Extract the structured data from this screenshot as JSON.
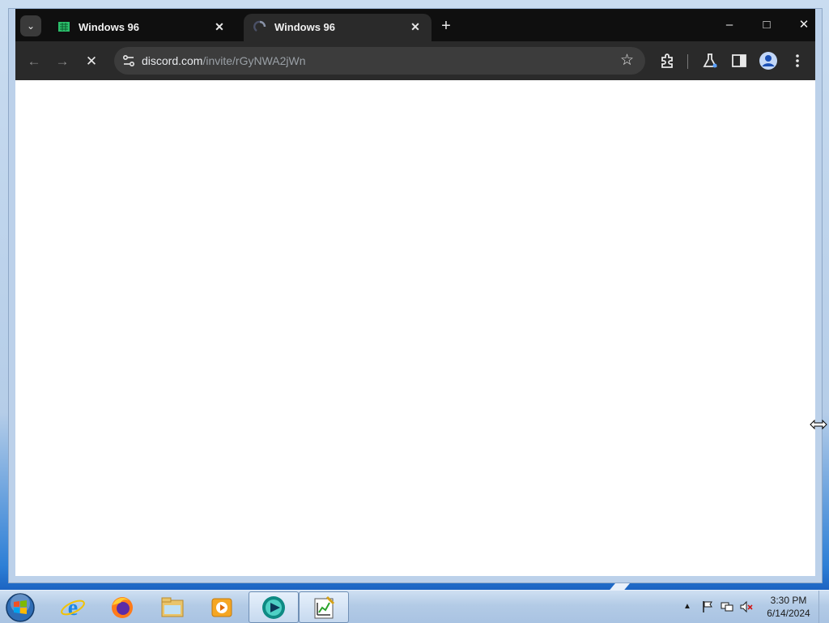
{
  "browser": {
    "tabs": [
      {
        "title": "Windows 96",
        "favicon": "windows96-green-icon",
        "active": false
      },
      {
        "title": "Windows 96",
        "favicon": "loading-spinner-icon",
        "active": true
      }
    ],
    "new_tab_icon": "plus-icon",
    "window_controls": [
      "minimize-icon",
      "maximize-icon",
      "close-icon"
    ],
    "url": {
      "host": "discord.com",
      "path": "/invite/rGyNWA2jWn"
    },
    "toolbar_icons": [
      "back-icon",
      "forward-icon",
      "stop-loading-icon",
      "site-info-icon",
      "bookmark-star-icon",
      "extensions-icon",
      "labs-flask-icon",
      "side-panel-icon",
      "profile-avatar-icon",
      "menu-kebab-icon"
    ]
  },
  "taskbar": {
    "pinned": [
      "start-orb-icon",
      "internet-explorer-icon",
      "firefox-icon",
      "file-explorer-icon",
      "media-player-icon",
      "chrome-app-icon",
      "notepad-chart-icon"
    ],
    "clock": {
      "time": "3:30 PM",
      "date": "6/14/2024"
    },
    "tray_icons": [
      "show-hidden-icon",
      "action-center-flag-icon",
      "network-icon",
      "volume-muted-icon"
    ]
  },
  "colors": {
    "frame": "#0f0f0f",
    "toolbar": "#2a2a2a",
    "omnibox": "#3c3c3c"
  }
}
